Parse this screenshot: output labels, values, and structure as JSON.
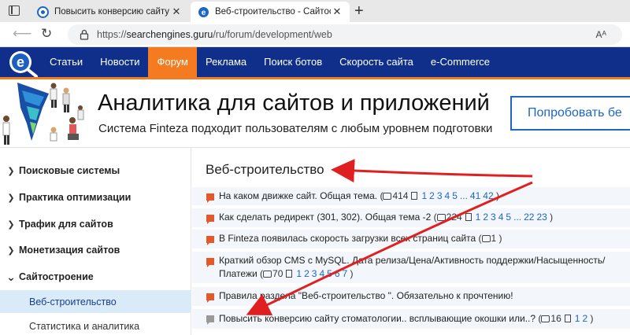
{
  "browser": {
    "tabs": [
      {
        "title": "Повысить конверсию сайту стом",
        "close": "✕"
      },
      {
        "title": "Веб-строительство - Сайтострое",
        "close": "✕"
      }
    ],
    "new_tab": "+",
    "url_prefix": "https://",
    "url_host": "searchengines.guru",
    "url_path": "/ru/forum/development/web",
    "reader_label": "Aᴬ"
  },
  "nav": {
    "items": [
      "Статьи",
      "Новости",
      "Форум",
      "Реклама",
      "Поиск ботов",
      "Скорость сайта",
      "e-Commerce"
    ],
    "active_index": 2,
    "accent": "#f47b20",
    "background": "#0f2f8a"
  },
  "banner": {
    "title": "Аналитика для сайтов и приложений",
    "subtitle": "Система Finteza подходит пользователям с любым уровнем подготовки",
    "button": "Попробовать бе"
  },
  "sidebar": {
    "items": [
      {
        "label": "Поисковые системы",
        "chevron": "❯"
      },
      {
        "label": "Практика оптимизации",
        "chevron": "❯"
      },
      {
        "label": "Трафик для сайтов",
        "chevron": "❯"
      },
      {
        "label": "Монетизация сайтов",
        "chevron": "❯"
      },
      {
        "label": "Сайтостроение",
        "chevron": "⌄"
      }
    ],
    "subitems": [
      {
        "label": "Веб-строительство",
        "selected": true
      },
      {
        "label": "Статистика и аналитика",
        "selected": false
      }
    ]
  },
  "forum": {
    "section_title": "Веб-строительство",
    "topics": [
      {
        "title": "На каком движке сайт. Общая тема.",
        "replies": "414",
        "pages": [
          "1",
          "2",
          "3",
          "4",
          "5",
          "...",
          "41",
          "42"
        ],
        "icon": "orange"
      },
      {
        "title": "Как сделать редирект (301, 302). Общая тема -2",
        "replies": "224",
        "pages": [
          "1",
          "2",
          "3",
          "4",
          "5",
          "...",
          "22",
          "23"
        ],
        "icon": "orange"
      },
      {
        "title": "В Finteza появилась скорость загрузки всех страниц сайта",
        "replies": "1",
        "pages": [],
        "icon": "orange"
      },
      {
        "title": "Краткий обзор CMS с MySQL. Дата релиза/Цена/Активность поддержки/Насыщенность/",
        "title_line2": "Платежи",
        "replies": "70",
        "pages": [
          "1",
          "2",
          "3",
          "4",
          "5",
          "6",
          "7"
        ],
        "icon": "orange"
      },
      {
        "title": "Правила раздела \"Веб-строительство \". Обязательно к прочтению!",
        "replies": "",
        "pages": [],
        "icon": "orange"
      },
      {
        "title": "Повысить конверсию сайту стоматологии.. всплывающие окошки или..?",
        "replies": "16",
        "pages": [
          "1",
          "2"
        ],
        "icon": "grey"
      }
    ]
  }
}
